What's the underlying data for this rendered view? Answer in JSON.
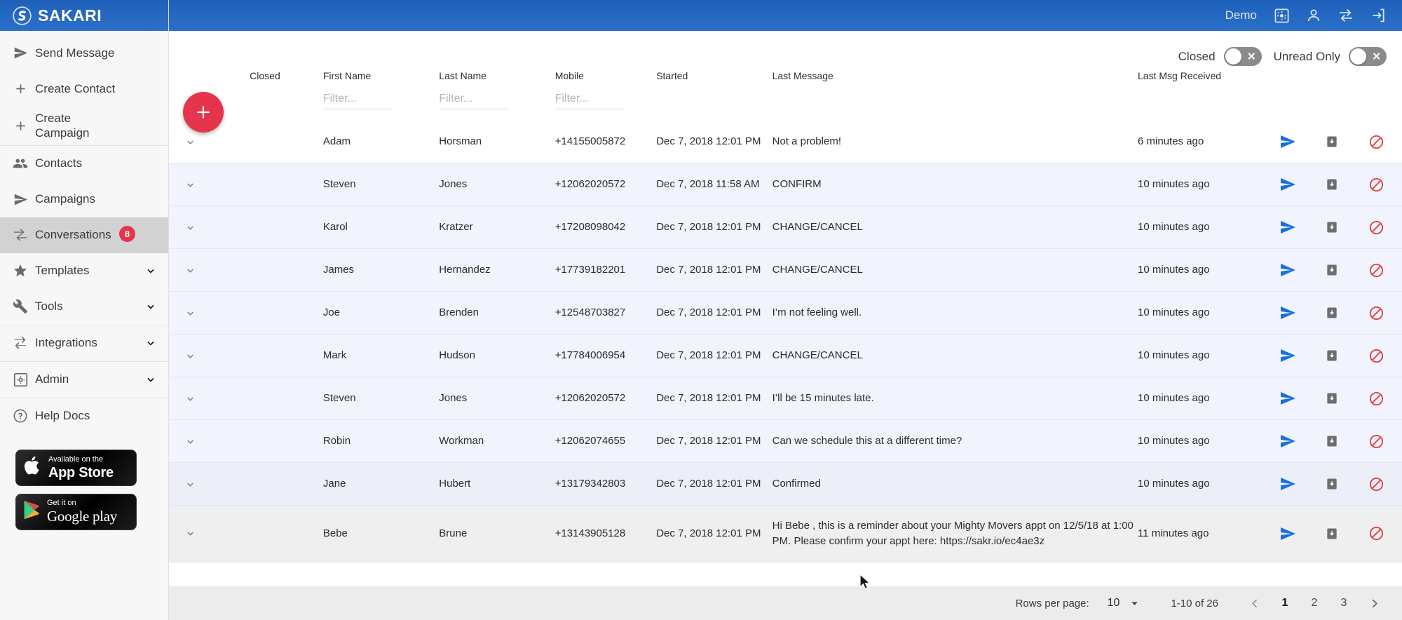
{
  "brand": {
    "name": "SAKARI",
    "logo_icon": "sakari-logo-icon"
  },
  "topbar": {
    "user_label": "Demo",
    "icons": [
      {
        "name": "settings-gear-icon",
        "label": "Settings"
      },
      {
        "name": "user-account-icon",
        "label": "Account"
      },
      {
        "name": "switch-account-icon",
        "label": "Switch Account"
      },
      {
        "name": "logout-icon",
        "label": "Log Out"
      }
    ]
  },
  "sidebar": {
    "groups": [
      {
        "items": [
          {
            "label": "Send Message",
            "icon": "send-arrow-icon",
            "chevron": false,
            "active": false
          },
          {
            "label": "Create Contact",
            "icon": "plus-icon",
            "chevron": false,
            "active": false
          },
          {
            "label": "Create Campaign",
            "icon": "plus-icon",
            "chevron": false,
            "active": false,
            "wrap": true
          }
        ]
      },
      {
        "items": [
          {
            "label": "Contacts",
            "icon": "people-icon",
            "chevron": false,
            "active": false
          },
          {
            "label": "Campaigns",
            "icon": "send-arrow-icon",
            "chevron": false,
            "active": false
          },
          {
            "label": "Conversations",
            "icon": "conversations-arrows-icon",
            "chevron": false,
            "active": true,
            "badge": "8"
          },
          {
            "label": "Templates",
            "icon": "star-icon",
            "chevron": true,
            "active": false
          },
          {
            "label": "Tools",
            "icon": "wrench-icon",
            "chevron": true,
            "active": false
          }
        ]
      },
      {
        "items": [
          {
            "label": "Integrations",
            "icon": "integrations-arrows-icon",
            "chevron": true,
            "active": false
          }
        ]
      },
      {
        "items": [
          {
            "label": "Admin",
            "icon": "admin-gear-icon",
            "chevron": true,
            "active": false
          }
        ]
      },
      {
        "items": [
          {
            "label": "Help Docs",
            "icon": "help-question-icon",
            "chevron": false,
            "active": false
          }
        ]
      }
    ],
    "store_badges": [
      {
        "name": "app-store-badge",
        "small": "Available on the",
        "big": "App Store",
        "icon": "apple-icon"
      },
      {
        "name": "google-play-badge",
        "small": "Get it on",
        "big": "Google play",
        "icon": "google-play-icon"
      }
    ]
  },
  "filters": {
    "closed": {
      "label": "Closed",
      "on": false,
      "icon": "toggle-off-x-icon"
    },
    "unread_only": {
      "label": "Unread Only",
      "on": false,
      "icon": "toggle-off-x-icon"
    }
  },
  "fab": {
    "label": "+",
    "name": "new-conversation-button",
    "color": "#e5344b"
  },
  "table": {
    "columns": [
      "",
      "Closed",
      "First Name",
      "Last Name",
      "Mobile",
      "Started",
      "Last Message",
      "Last Msg Received",
      ""
    ],
    "filter_placeholders": {
      "first_name": "Filter...",
      "last_name": "Filter...",
      "mobile": "Filter..."
    },
    "filter_values": {
      "first_name": "",
      "last_name": "",
      "mobile": ""
    },
    "row_actions": [
      {
        "name": "send-message-action-icon",
        "color": "#1a6fe0"
      },
      {
        "name": "archive-action-icon",
        "color": "#6e6e6e"
      },
      {
        "name": "block-action-icon",
        "color": "#e03b3b"
      }
    ],
    "rows": [
      {
        "first_name": "Adam",
        "last_name": "Horsman",
        "mobile": "+14155005872",
        "started": "Dec 7, 2018 12:01 PM",
        "last_message": "Not a problem!",
        "received": "6 minutes ago",
        "shade": "white"
      },
      {
        "first_name": "Steven",
        "last_name": "Jones",
        "mobile": "+12062020572",
        "started": "Dec 7, 2018 11:58 AM",
        "last_message": "CONFIRM",
        "received": "10 minutes ago",
        "shade": "tint"
      },
      {
        "first_name": "Karol",
        "last_name": "Kratzer",
        "mobile": "+17208098042",
        "started": "Dec 7, 2018 12:01 PM",
        "last_message": "CHANGE/CANCEL",
        "received": "10 minutes ago",
        "shade": "tint"
      },
      {
        "first_name": "James",
        "last_name": "Hernandez",
        "mobile": "+17739182201",
        "started": "Dec 7, 2018 12:01 PM",
        "last_message": "CHANGE/CANCEL",
        "received": "10 minutes ago",
        "shade": "tint"
      },
      {
        "first_name": "Joe",
        "last_name": "Brenden",
        "mobile": "+12548703827",
        "started": "Dec 7, 2018 12:01 PM",
        "last_message": "I’m not feeling well.",
        "received": "10 minutes ago",
        "shade": "tint"
      },
      {
        "first_name": "Mark",
        "last_name": "Hudson",
        "mobile": "+17784006954",
        "started": "Dec 7, 2018 12:01 PM",
        "last_message": "CHANGE/CANCEL",
        "received": "10 minutes ago",
        "shade": "tint"
      },
      {
        "first_name": "Steven",
        "last_name": "Jones",
        "mobile": "+12062020572",
        "started": "Dec 7, 2018 12:01 PM",
        "last_message": "I’ll be 15 minutes late.",
        "received": "10 minutes ago",
        "shade": "tint"
      },
      {
        "first_name": "Robin",
        "last_name": "Workman",
        "mobile": "+12062074655",
        "started": "Dec 7, 2018 12:01 PM",
        "last_message": "Can we schedule this at a different time?",
        "received": "10 minutes ago",
        "shade": "tint"
      },
      {
        "first_name": "Jane",
        "last_name": "Hubert",
        "mobile": "+13179342803",
        "started": "Dec 7, 2018 12:01 PM",
        "last_message": "Confirmed",
        "received": "10 minutes ago",
        "shade": "tint2"
      },
      {
        "first_name": "Bebe",
        "last_name": "Brune",
        "mobile": "+13143905128",
        "started": "Dec 7, 2018 12:01 PM",
        "last_message": "Hi Bebe , this is a reminder about your Mighty Movers appt on 12/5/18 at 1:00 PM. Please confirm your appt here: https://sakr.io/ec4ae3z",
        "received": "11 minutes ago",
        "shade": "tint3"
      }
    ]
  },
  "pagination": {
    "rows_per_page_label": "Rows per page:",
    "rows_per_page_value": "10",
    "range_label": "1-10 of 26",
    "pages": [
      "1",
      "2",
      "3"
    ],
    "current_page": "1",
    "prev_icon": "chevron-left-icon",
    "next_icon": "chevron-right-icon"
  }
}
